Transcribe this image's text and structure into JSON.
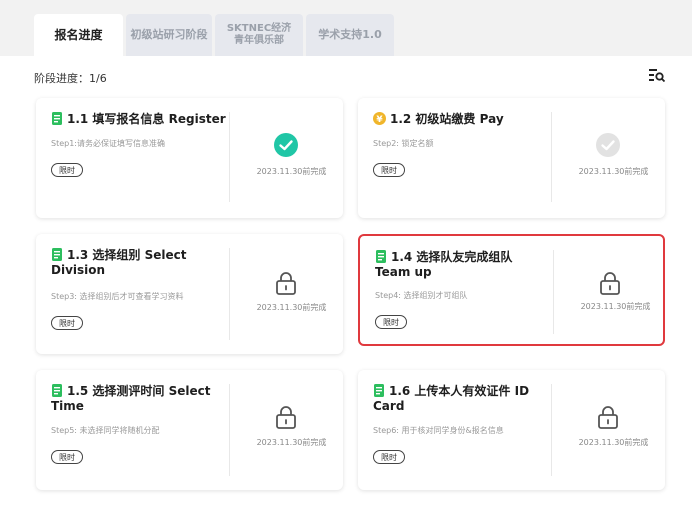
{
  "tabs": [
    {
      "label": "报名进度",
      "active": true
    },
    {
      "label": "初级站研习阶段",
      "active": false
    },
    {
      "label_line1": "SKTNEC经济",
      "label_line2": "青年俱乐部",
      "active": false
    },
    {
      "label": "学术支持1.0",
      "active": false
    }
  ],
  "progress": {
    "label": "阶段进度：1/6"
  },
  "colors": {
    "green": "#2cbe5e",
    "gold": "#f0b52a",
    "teal": "#20c6a6",
    "selected_border": "#e0393e"
  },
  "cards": [
    {
      "title": "1.1 填写报名信息 Register",
      "step": "Step1:请务必保证填写信息准确",
      "limit": "限时",
      "deadline": "2023.11.30前完成",
      "status": "done",
      "title_icon": "doc-icon"
    },
    {
      "title": "1.2 初级站缴费 Pay",
      "step": "Step2: 锁定名额",
      "limit": "限时",
      "deadline": "2023.11.30前完成",
      "status": "pending",
      "title_icon": "yen-coin-icon"
    },
    {
      "title": "1.3 选择组别 Select Division",
      "step": "Step3: 选择组别后才可查看学习资料",
      "limit": "限时",
      "deadline": "2023.11.30前完成",
      "status": "locked",
      "title_icon": "doc-icon"
    },
    {
      "title": "1.4 选择队友完成组队 Team up",
      "step": "Step4: 选择组别才可组队",
      "limit": "限时",
      "deadline": "2023.11.30前完成",
      "status": "locked",
      "title_icon": "doc-icon",
      "selected": true
    },
    {
      "title": "1.5 选择测评时间 Select Time",
      "step": "Step5: 未选择同学将随机分配",
      "limit": "限时",
      "deadline": "2023.11.30前完成",
      "status": "locked",
      "title_icon": "doc-icon"
    },
    {
      "title": "1.6 上传本人有效证件 ID Card",
      "step": "Step6: 用于核对同学身份&报名信息",
      "limit": "限时",
      "deadline": "2023.11.30前完成",
      "status": "locked",
      "title_icon": "doc-icon"
    }
  ]
}
